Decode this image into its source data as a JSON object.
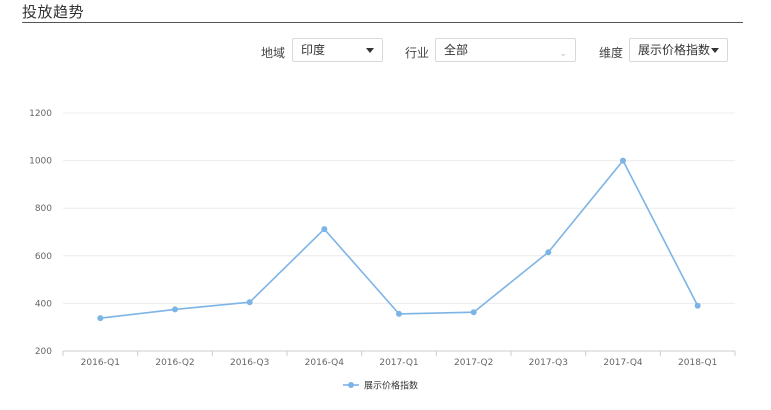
{
  "header": {
    "title": "投放趋势"
  },
  "filters": {
    "region": {
      "label": "地域",
      "value": "印度"
    },
    "industry": {
      "label": "行业",
      "value": "全部"
    },
    "dimension": {
      "label": "维度",
      "value": "展示价格指数"
    }
  },
  "colors": {
    "series": "#7db4e6",
    "grid": "#ececec",
    "axis": "#cccccc",
    "tick": "#666666"
  },
  "chart_data": {
    "type": "line",
    "categories": [
      "2016-Q1",
      "2016-Q2",
      "2016-Q3",
      "2016-Q4",
      "2017-Q1",
      "2017-Q2",
      "2017-Q3",
      "2017-Q4",
      "2018-Q1"
    ],
    "series": [
      {
        "name": "展示价格指数",
        "values": [
          338,
          375,
          405,
          712,
          356,
          363,
          615,
          1000,
          390
        ]
      }
    ],
    "yticks": [
      200,
      400,
      600,
      800,
      1000,
      1200
    ],
    "ylim": [
      200,
      1200
    ],
    "grid": true,
    "legend": "bottom-center",
    "title": "",
    "xlabel": "",
    "ylabel": ""
  }
}
